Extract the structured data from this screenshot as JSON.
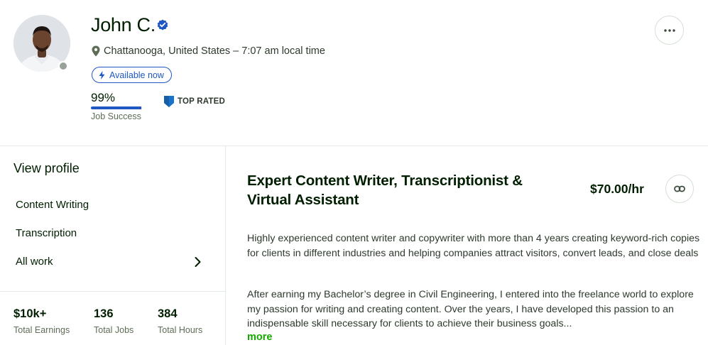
{
  "profile": {
    "name": "John C.",
    "location": "Chattanooga, United States – 7:07 am local time",
    "availability": "Available now",
    "job_success": {
      "value": "99%",
      "label": "Job Success",
      "fraction": 0.99
    },
    "badge": "TOP RATED",
    "avatar_alt": "John C. profile photo"
  },
  "sidebar": {
    "heading": "View profile",
    "items": [
      {
        "label": "Content Writing"
      },
      {
        "label": "Transcription"
      },
      {
        "label": "All work"
      }
    ],
    "stats": [
      {
        "value": "$10k+",
        "label": "Total Earnings"
      },
      {
        "value": "136",
        "label": "Total Jobs"
      },
      {
        "value": "384",
        "label": "Total Hours"
      }
    ]
  },
  "main": {
    "title": "Expert Content Writer, Transcriptionist & Virtual Assistant",
    "rate": "$70.00/hr",
    "paragraphs": [
      "Highly experienced content writer and copywriter with more than 4 years creating keyword-rich copies for clients in different industries and helping companies attract visitors, convert leads, and close deals",
      "After earning my Bachelor’s degree in Civil Engineering, I entered into the freelance world to explore my passion for writing and creating content. Over the years, I have developed this passion to an indispensable skill necessary for clients to achieve their business goals..."
    ],
    "more_label": "more"
  },
  "colors": {
    "brand_green": "#14a800",
    "accent_blue": "#1f57c3",
    "top_rated_blue": "#1a73c9",
    "text": "#001e00"
  },
  "icons": [
    "verified-badge-icon",
    "location-pin-icon",
    "lightning-icon",
    "top-rated-badge-icon",
    "more-options-icon",
    "chevron-right-icon",
    "link-icon"
  ]
}
